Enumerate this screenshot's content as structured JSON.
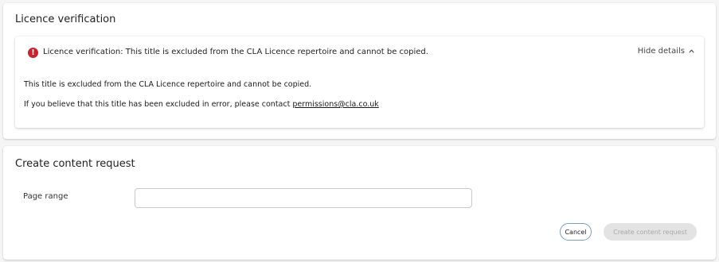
{
  "licence_card": {
    "title": "Licence verification",
    "alert": {
      "icon": "error-icon",
      "icon_glyph": "!",
      "summary": "Licence verification: This title is excluded from the CLA Licence repertoire and cannot be copied.",
      "toggle_label": "Hide details",
      "detail_line_1": "This title is excluded from the CLA Licence repertoire and cannot be copied.",
      "detail_line_2_prefix": "If you believe that this title has been excluded in error, please contact ",
      "contact_email": "permissions@cla.co.uk"
    }
  },
  "request_card": {
    "title": "Create content request",
    "page_range": {
      "label": "Page range",
      "value": "",
      "placeholder": ""
    },
    "cancel_label": "Cancel",
    "create_label": "Create content request"
  },
  "colors": {
    "error": "#c8232c",
    "disabled_button_bg": "#e3e3e3",
    "disabled_button_text": "#a8a8a8",
    "cancel_border": "#7a9fbf"
  }
}
